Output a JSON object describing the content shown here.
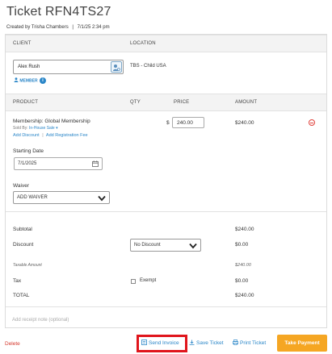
{
  "ticket": {
    "title": "Ticket RFN4TS27",
    "created_by": "Created by Trisha Chambers",
    "created_sep": "|",
    "created_at": "7/1/25 2:34 pm"
  },
  "client_section": {
    "client_header": "CLIENT",
    "location_header": "LOCATION",
    "client_value": "Alex Rush",
    "member_label": "MEMBER",
    "location_value": "TBS - Child USA"
  },
  "product_section": {
    "headers": {
      "product": "PRODUCT",
      "qty": "QTY",
      "price": "PRICE",
      "amount": "AMOUNT"
    },
    "item": {
      "name": "Membership: Global Membership",
      "sold_by_label": "Sold By:",
      "sold_by_value": "In-House Sale",
      "add_discount": "Add Discount",
      "sep": "|",
      "add_registration_fee": "Add Registration Fee",
      "currency": "$",
      "price": "240.00",
      "amount": "$240.00"
    },
    "starting_date_label": "Starting Date",
    "starting_date_value": "7/1/2025",
    "waiver_label": "Waiver",
    "waiver_select": "ADD WAIVER"
  },
  "totals": {
    "subtotal_label": "Subtotal",
    "subtotal_value": "$240.00",
    "discount_label": "Discount",
    "discount_select": "No Discount",
    "discount_value": "$0.00",
    "taxable_label": "Taxable Amount",
    "taxable_value": "$240.00",
    "tax_label": "Tax",
    "exempt_label": "Exempt",
    "tax_value": "$0.00",
    "total_label": "TOTAL",
    "total_value": "$240.00"
  },
  "receipt_note_placeholder": "Add receipt note (optional)",
  "footer": {
    "delete": "Delete",
    "send_invoice": "Send Invoice",
    "save_ticket": "Save Ticket",
    "print_ticket": "Print Ticket",
    "take_payment": "Take Payment"
  },
  "colors": {
    "link": "#2a86c8",
    "accent": "#f5a623",
    "danger": "#d53a2f",
    "highlight": "#e0151c"
  }
}
